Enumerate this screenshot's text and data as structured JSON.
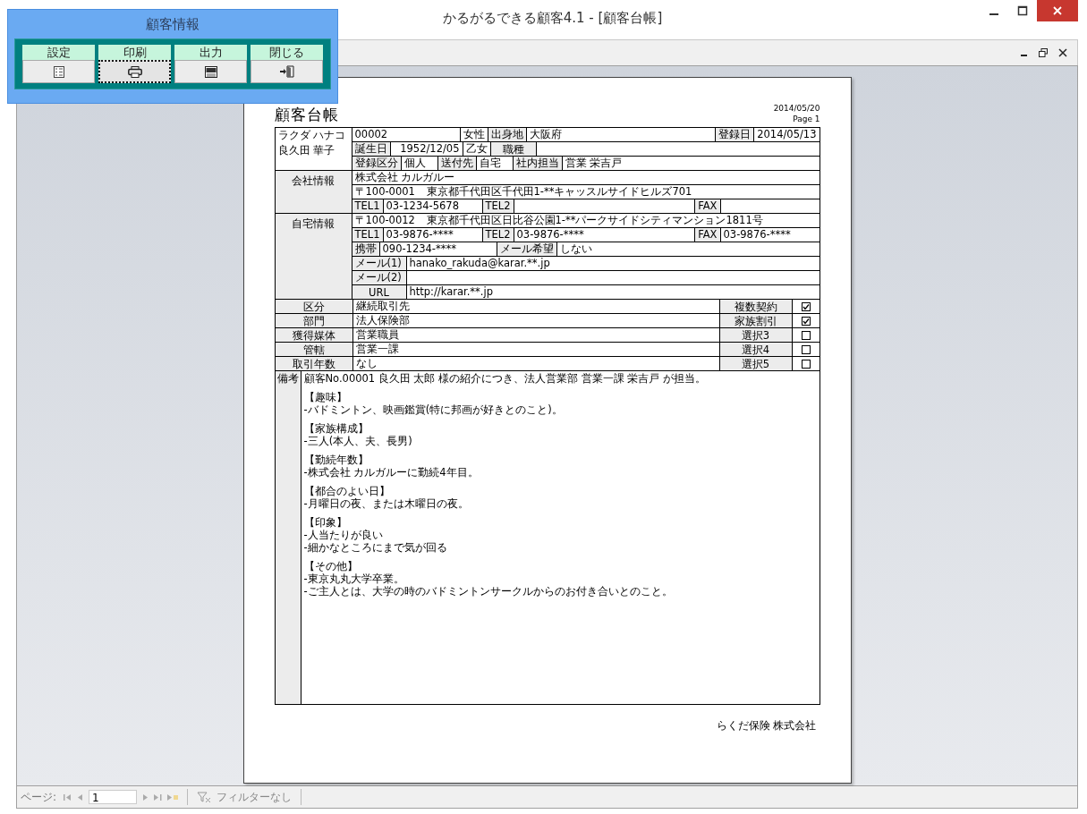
{
  "window": {
    "title": "かるがるできる顧客4.1 - [顧客台帳]"
  },
  "panel": {
    "title": "顧客情報",
    "buttons": [
      {
        "label": "設定",
        "kind": "settings",
        "focused": false
      },
      {
        "label": "印刷",
        "kind": "print",
        "focused": true
      },
      {
        "label": "出力",
        "kind": "pdf",
        "focused": false
      },
      {
        "label": "閉じる",
        "kind": "exit",
        "focused": false
      }
    ]
  },
  "report": {
    "title": "顧客台帳",
    "date": "2014/05/20",
    "page": "Page 1",
    "profile": {
      "kana": "ラクダ ハナコ",
      "name": "良久田 華子",
      "customer_no": "00002",
      "gender": "女性",
      "birthplace_label": "出身地",
      "birthplace": "大阪府",
      "registered_label": "登録日",
      "registered": "2014/05/13",
      "birthday_label": "誕生日",
      "birthday": "1952/12/05",
      "sign": "乙女",
      "job_label": "職種",
      "category_label": "登録区分",
      "category": "個人",
      "send_label": "送付先",
      "send": "自宅",
      "staff_label": "社内担当",
      "staff": "営業 栄吉戸"
    },
    "company": {
      "label": "会社情報",
      "name": "株式会社 カルガルー",
      "postal": "〒100-0001",
      "address": "東京都千代田区千代田1-**キャッスルサイドヒルズ701",
      "tel1_label": "TEL1",
      "tel1": "03-1234-5678",
      "tel2_label": "TEL2",
      "fax_label": "FAX"
    },
    "home": {
      "label": "自宅情報",
      "postal": "〒100-0012",
      "address": "東京都千代田区日比谷公園1-**パークサイドシティマンション1811号",
      "tel1_label": "TEL1",
      "tel1": "03-9876-****",
      "tel2_label": "TEL2",
      "tel2": "03-9876-****",
      "fax_label": "FAX",
      "fax": "03-9876-****",
      "mobile_label": "携帯",
      "mobile": "090-1234-****",
      "mail_wish_label": "メール希望",
      "mail_wish": "しない",
      "mail1_label": "メール(1)",
      "mail1": "hanako_rakuda@karar.**.jp",
      "mail2_label": "メール(2)",
      "url_label": "URL",
      "url": "http://karar.**.jp"
    },
    "attributes": [
      {
        "label": "区分",
        "value": "継続取引先",
        "option_label": "複数契約",
        "checked": true
      },
      {
        "label": "部門",
        "value": "法人保険部",
        "option_label": "家族割引",
        "checked": true
      },
      {
        "label": "獲得媒体",
        "value": "営業職員",
        "option_label": "選択3",
        "checked": false
      },
      {
        "label": "管轄",
        "value": "営業一課",
        "option_label": "選択4",
        "checked": false
      },
      {
        "label": "取引年数",
        "value": "なし",
        "option_label": "選択5",
        "checked": false
      }
    ],
    "notes": {
      "label": "備考",
      "intro": "顧客No.00001 良久田 太郎 様の紹介につき、法人営業部 営業一課 栄吉戸 が担当。",
      "sections": [
        {
          "heading": "【趣味】",
          "lines": [
            "-バドミントン、映画鑑賞(特に邦画が好きとのこと)。"
          ]
        },
        {
          "heading": "【家族構成】",
          "lines": [
            "-三人(本人、夫、長男)"
          ]
        },
        {
          "heading": "【勤続年数】",
          "lines": [
            "-株式会社 カルガルーに勤続4年目。"
          ]
        },
        {
          "heading": "【都合のよい日】",
          "lines": [
            "-月曜日の夜、または木曜日の夜。"
          ]
        },
        {
          "heading": "【印象】",
          "lines": [
            "-人当たりが良い",
            "-細かなところにまで気が回る"
          ]
        },
        {
          "heading": "【その他】",
          "lines": [
            "-東京丸丸大学卒業。",
            "-ご主人とは、大学の時のバドミントンサークルからのお付き合いとのこと。"
          ]
        }
      ]
    },
    "footer": "らくだ保険 株式会社"
  },
  "status_bar": {
    "page_label": "ページ:",
    "page_value": "1",
    "filter": "フィルターなし"
  }
}
